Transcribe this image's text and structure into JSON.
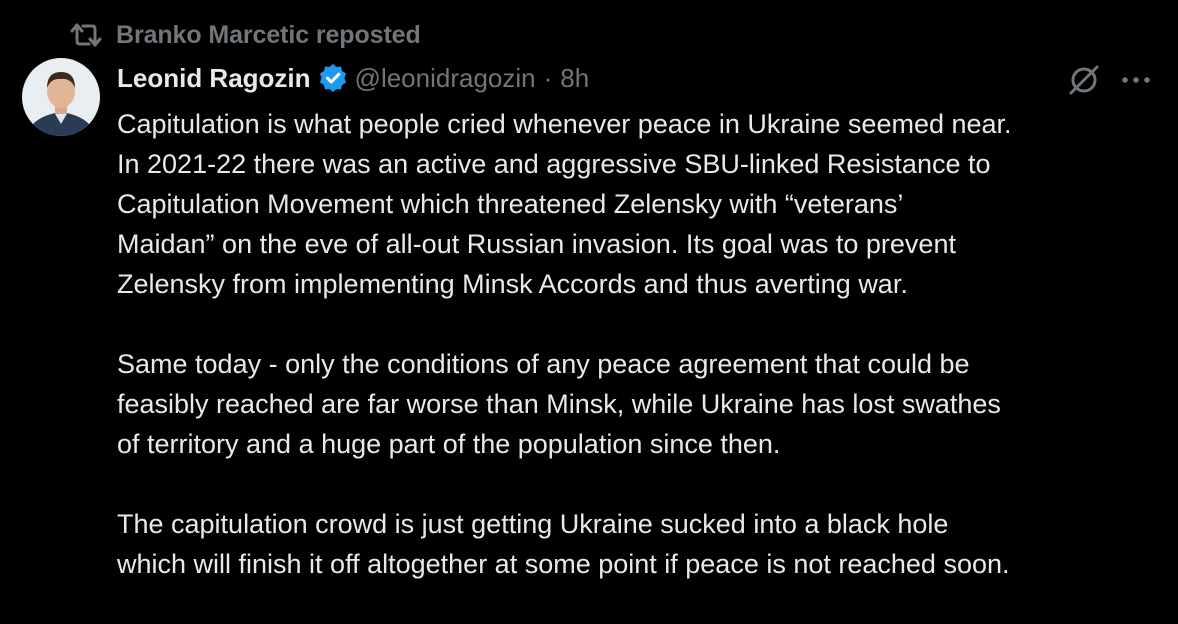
{
  "colors": {
    "background": "#000000",
    "primary_text": "#e7e9ea",
    "secondary_text": "#71767b",
    "verified_badge": "#1d9bf0"
  },
  "repost": {
    "icon": "repost-icon",
    "label": "Branko Marcetic reposted"
  },
  "tweet": {
    "author": {
      "display_name": "Leonid Ragozin",
      "verified_icon": "verified-badge-icon",
      "handle": "@leonidragozin",
      "separator": "·",
      "time": "8h"
    },
    "actions": {
      "grok_icon": "grok-icon",
      "more_icon": "more-options-icon"
    },
    "paragraphs": [
      "Capitulation is what people cried whenever peace in Ukraine seemed near.\nIn 2021-22 there was an active and aggressive SBU-linked Resistance to\nCapitulation Movement which threatened Zelensky with “veterans’\nMaidan” on the eve of all-out Russian invasion. Its goal was to prevent\nZelensky from implementing Minsk Accords and thus averting war.",
      "Same today - only the conditions of any peace agreement that could be\nfeasibly reached are far worse than Minsk, while Ukraine has lost swathes\nof territory and a huge part of the population since then.",
      "The capitulation crowd is just getting Ukraine sucked into a black hole\nwhich will finish it off altogether at some point if peace is not reached soon."
    ]
  }
}
